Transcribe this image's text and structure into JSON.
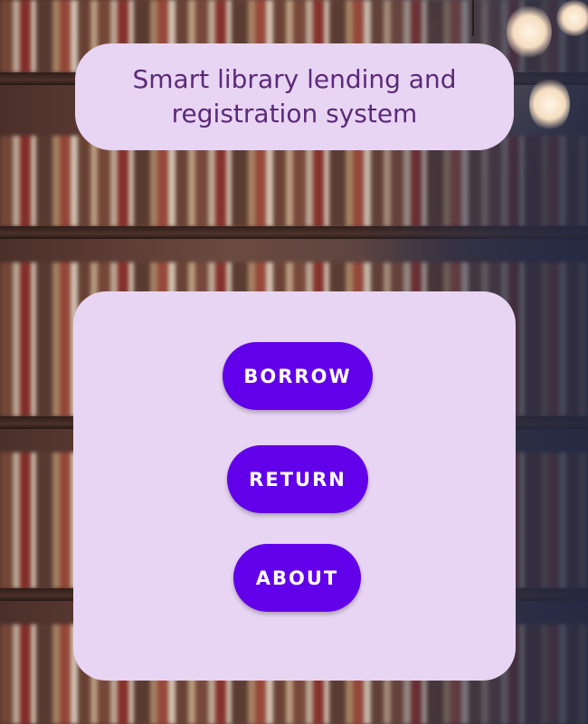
{
  "app": {
    "title": "Smart library lending and registration system"
  },
  "actions": {
    "borrow_label": "BORROW",
    "return_label": "RETURN",
    "about_label": "ABOUT"
  },
  "colors": {
    "card_background": "#e8d5f3",
    "title_text": "#5b2a78",
    "button_primary": "#6200ea",
    "button_text": "#ffffff"
  }
}
